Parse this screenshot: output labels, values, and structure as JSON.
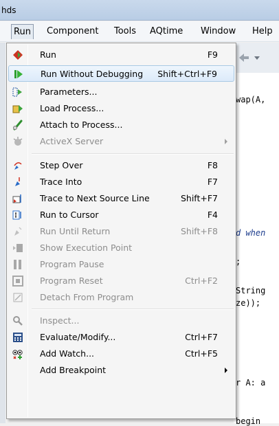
{
  "window": {
    "title": "hds"
  },
  "menubar": {
    "items": [
      "Run",
      "Component",
      "Tools",
      "AQtime",
      "Window",
      "Help"
    ],
    "active": "Run"
  },
  "editor": {
    "lines": [
      "wap(A,",
      "d when",
      ";",
      "String",
      "ze));",
      "r A: a",
      "begin"
    ]
  },
  "run_menu": {
    "items": [
      {
        "label": "Run",
        "shortcut": "F9",
        "icon": "run-icon",
        "enabled": true
      },
      {
        "label": "Run Without Debugging",
        "shortcut": "Shift+Ctrl+F9",
        "icon": "run-without-debugging-icon",
        "enabled": true,
        "highlighted": true
      },
      {
        "label": "Parameters...",
        "shortcut": "",
        "icon": "parameters-icon",
        "enabled": true
      },
      {
        "label": "Load Process...",
        "shortcut": "",
        "icon": "load-process-icon",
        "enabled": true
      },
      {
        "label": "Attach to Process...",
        "shortcut": "",
        "icon": "attach-process-icon",
        "enabled": true
      },
      {
        "label": "ActiveX Server",
        "shortcut": "",
        "icon": "activex-server-icon",
        "enabled": false,
        "submenu": true
      },
      {
        "label": "Step Over",
        "shortcut": "F8",
        "icon": "step-over-icon",
        "enabled": true
      },
      {
        "label": "Trace Into",
        "shortcut": "F7",
        "icon": "trace-into-icon",
        "enabled": true
      },
      {
        "label": "Trace to Next Source Line",
        "shortcut": "Shift+F7",
        "icon": "trace-next-line-icon",
        "enabled": true
      },
      {
        "label": "Run to Cursor",
        "shortcut": "F4",
        "icon": "run-to-cursor-icon",
        "enabled": true
      },
      {
        "label": "Run Until Return",
        "shortcut": "Shift+F8",
        "icon": "run-until-return-icon",
        "enabled": false
      },
      {
        "label": "Show Execution Point",
        "shortcut": "",
        "icon": "show-execution-point-icon",
        "enabled": false
      },
      {
        "label": "Program Pause",
        "shortcut": "",
        "icon": "pause-icon",
        "enabled": false
      },
      {
        "label": "Program Reset",
        "shortcut": "Ctrl+F2",
        "icon": "reset-icon",
        "enabled": false
      },
      {
        "label": "Detach From Program",
        "shortcut": "",
        "icon": "detach-icon",
        "enabled": false
      },
      {
        "label": "Inspect...",
        "shortcut": "",
        "icon": "inspect-icon",
        "enabled": false
      },
      {
        "label": "Evaluate/Modify...",
        "shortcut": "Ctrl+F7",
        "icon": "evaluate-icon",
        "enabled": true
      },
      {
        "label": "Add Watch...",
        "shortcut": "Ctrl+F5",
        "icon": "add-watch-icon",
        "enabled": true
      },
      {
        "label": "Add Breakpoint",
        "shortcut": "",
        "icon": "",
        "enabled": true,
        "submenu": true
      }
    ]
  }
}
